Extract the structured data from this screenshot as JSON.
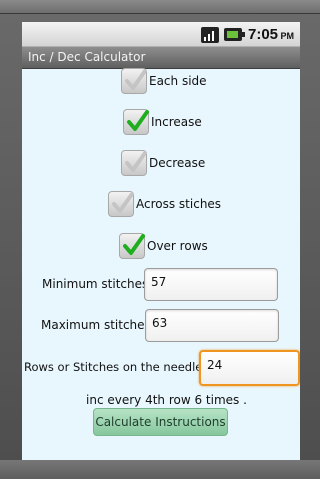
{
  "status_bar": {
    "time": "7:05",
    "ampm": "PM"
  },
  "app": {
    "title": "Inc / Dec Calculator"
  },
  "checkboxes": [
    {
      "label": "Each side",
      "checked": false
    },
    {
      "label": "Increase",
      "checked": true
    },
    {
      "label": "Decrease",
      "checked": false
    },
    {
      "label": "Across stiches",
      "checked": false
    },
    {
      "label": "Over rows",
      "checked": true
    }
  ],
  "fields": {
    "min_label": "Minimum stitches",
    "min_value": "57",
    "max_label": "Maximum stitches",
    "max_value": "63",
    "needle_label": "Rows or Stitches on the needle",
    "needle_value": "24"
  },
  "result": {
    "text": "inc  every 4th row 6 times ."
  },
  "button": {
    "label": "Calculate Instructions"
  },
  "colors": {
    "accent_focus": "#f09520",
    "check_on": "#1fae1f",
    "button_bg": "#9fd6b1"
  }
}
